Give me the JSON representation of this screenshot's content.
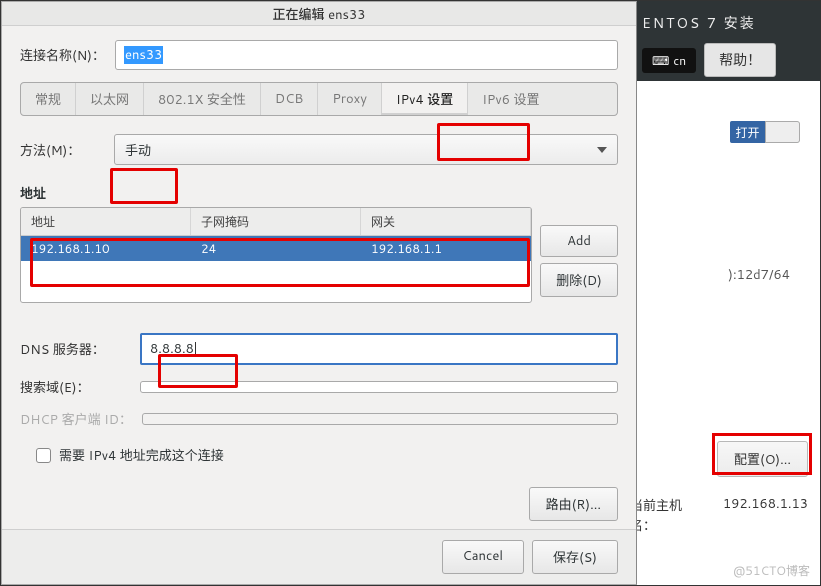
{
  "installer": {
    "title": "ENTOS 7 安装",
    "keyboard": "cn",
    "help_label": "帮助！",
    "switch_on_label": "打开",
    "ipv6_sample": "):12d7/64",
    "configure_label": "配置(O)...",
    "hostname_label": "当前主机名：",
    "hostname_value": "192.168.1.13",
    "watermark": "@51CTO博客"
  },
  "dialog": {
    "title": "正在编辑 ens33",
    "conn_label": "连接名称(N)：",
    "conn_value": "ens33",
    "tabs": [
      "常规",
      "以太网",
      "802.1X 安全性",
      "DCB",
      "Proxy",
      "IPv4 设置",
      "IPv6 设置"
    ],
    "method_label": "方法(M)：",
    "method_value": "手动",
    "addr_heading": "地址",
    "addr_cols": [
      "地址",
      "子网掩码",
      "网关"
    ],
    "addr_row": {
      "ip": "192.168.1.10",
      "mask": "24",
      "gw": "192.168.1.1"
    },
    "add_label": "Add",
    "delete_label": "删除(D)",
    "dns_label": "DNS 服务器：",
    "dns_value": "8.8.8.8",
    "search_label": "搜索域(E)：",
    "dhcp_label": "DHCP 客户端 ID：",
    "require_label": "需要 IPv4 地址完成这个连接",
    "route_label": "路由(R)...",
    "cancel_label": "Cancel",
    "save_label": "保存(S)"
  }
}
